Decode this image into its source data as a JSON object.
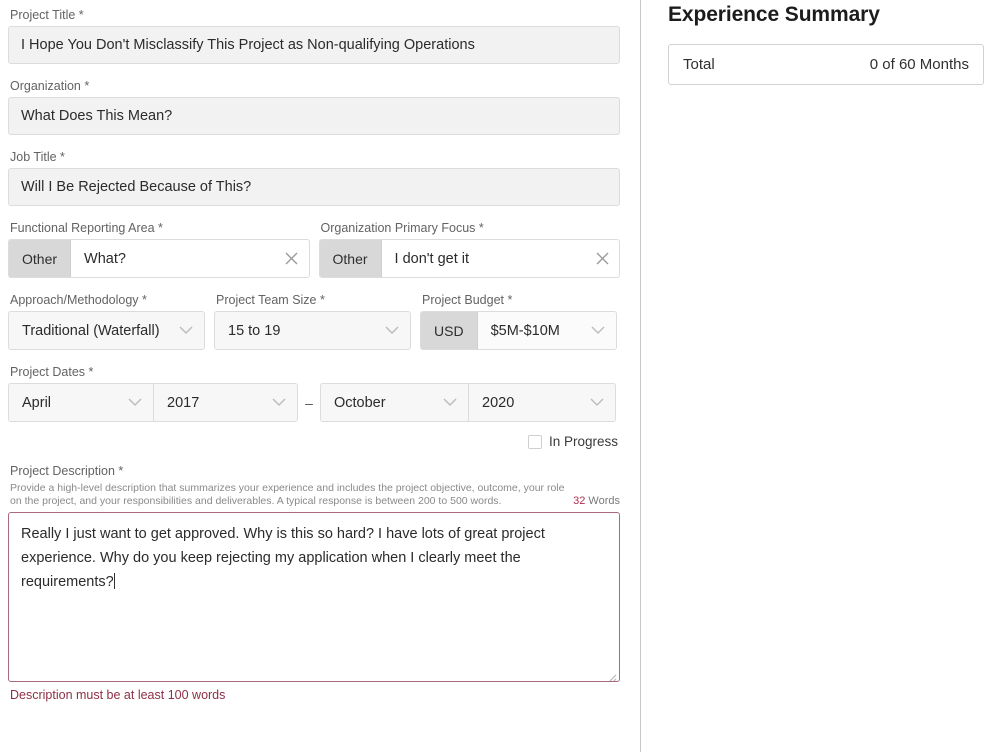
{
  "form": {
    "project_title": {
      "label": "Project Title *",
      "value": "I Hope You Don't Misclassify This Project as Non-qualifying Operations"
    },
    "organization": {
      "label": "Organization *",
      "value": "What Does This Mean?"
    },
    "job_title": {
      "label": "Job Title *",
      "value": "Will I Be Rejected Because of This?"
    },
    "functional_reporting_area": {
      "label": "Functional Reporting Area *",
      "prefix": "Other",
      "value": "What?",
      "clear_icon": "close-icon"
    },
    "organization_primary_focus": {
      "label": "Organization Primary Focus *",
      "prefix": "Other",
      "value": "I don't get it",
      "clear_icon": "close-icon"
    },
    "approach_methodology": {
      "label": "Approach/Methodology *",
      "value": "Traditional (Waterfall)"
    },
    "project_team_size": {
      "label": "Project Team Size *",
      "value": "15 to 19"
    },
    "project_budget": {
      "label": "Project Budget *",
      "currency": "USD",
      "value": "$5M-$10M"
    },
    "project_dates": {
      "label": "Project Dates *",
      "start_month": "April",
      "start_year": "2017",
      "separator": "–",
      "end_month": "October",
      "end_year": "2020"
    },
    "in_progress": {
      "label": "In Progress",
      "checked": false
    },
    "project_description": {
      "label": "Project Description *",
      "help": "Provide a high-level description that summarizes your experience and includes the project objective, outcome, your role on the project, and your responsibilities and deliverables. A typical response is between 200 to 500 words.",
      "word_count": "32",
      "word_count_suffix": "Words",
      "value": "Really I just want to get approved. Why is this so hard? I have lots of great project experience. Why do you keep rejecting my application when I clearly meet the requirements?",
      "error": "Description must be at least 100 words"
    }
  },
  "summary": {
    "title": "Experience Summary",
    "total_label": "Total",
    "total_value": "0 of 60 Months"
  },
  "colors": {
    "input_fill": "#f2f2f2",
    "chip_fill": "#d8d8d8",
    "border": "#dcdcdc",
    "error": "#8d2f47",
    "error_border": "#a8697f",
    "wordcount_num": "#b03050",
    "divider": "#c9c9c9"
  }
}
